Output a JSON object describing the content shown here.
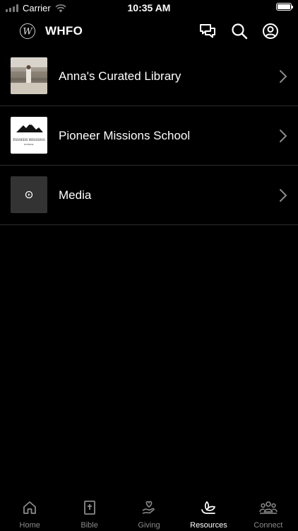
{
  "status": {
    "carrier": "Carrier",
    "time": "10:35 AM",
    "battery_level": 1.0
  },
  "header": {
    "title": "WHFO",
    "logo_text": "W"
  },
  "items": [
    {
      "label": "Anna's Curated Library"
    },
    {
      "label": "Pioneer Missions School",
      "thumb_line1": "PIONEER MISSIONS",
      "thumb_line2": "SCHOOL"
    },
    {
      "label": "Media"
    }
  ],
  "tabs": [
    {
      "label": "Home",
      "icon": "home-icon"
    },
    {
      "label": "Bible",
      "icon": "bible-icon"
    },
    {
      "label": "Giving",
      "icon": "giving-icon"
    },
    {
      "label": "Resources",
      "icon": "resources-icon",
      "active": true
    },
    {
      "label": "Connect",
      "icon": "connect-icon"
    }
  ],
  "colors": {
    "background": "#000000",
    "text": "#ffffff",
    "inactive": "#8a8a8a",
    "divider": "#2c2c2c"
  }
}
